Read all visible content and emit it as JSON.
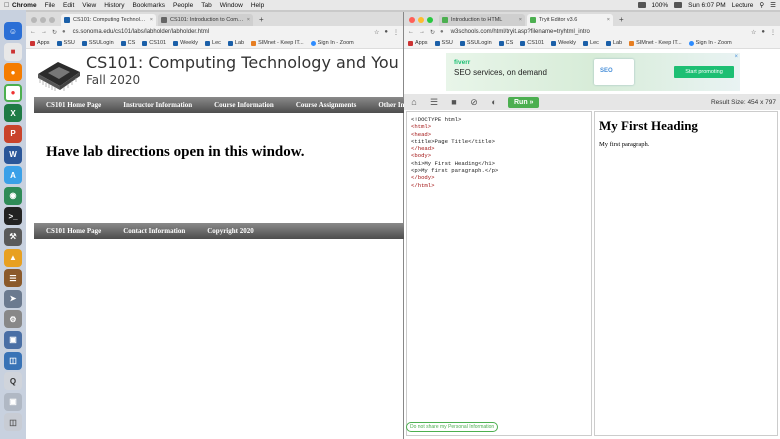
{
  "menubar": {
    "app": "Chrome",
    "items": [
      "File",
      "Edit",
      "View",
      "History",
      "Bookmarks",
      "People",
      "Tab",
      "Window",
      "Help"
    ],
    "battery": "100%",
    "clock": "Sun 6:07 PM",
    "user": "Lecture"
  },
  "left_window": {
    "tabs": [
      {
        "title": "CS101: Computing Technolog...",
        "active": true
      },
      {
        "title": "CS101: Introduction to Compu...",
        "active": false
      }
    ],
    "url": "cs.sonoma.edu/cs101/labs/labholder/labholder.html",
    "bookmarks": [
      "Apps",
      "SSU",
      "SSULogin",
      "CS",
      "CS101",
      "Weekly",
      "Lec",
      "Lab",
      "SIMnet - Keep IT...",
      "Sign In - Zoom"
    ],
    "page": {
      "title": "CS101: Computing Technology and You",
      "subtitle": "Fall 2020",
      "nav": [
        "CS101 Home Page",
        "Instructor Information",
        "Course Information",
        "Course Assignments",
        "Other Information"
      ],
      "heading": "Have lab directions open in this window.",
      "footer": [
        "CS101 Home Page",
        "Contact Information",
        "Copyright 2020"
      ]
    }
  },
  "right_window": {
    "tabs": [
      {
        "title": "Introduction to HTML",
        "active": false
      },
      {
        "title": "Tryit Editor v3.6",
        "active": true
      }
    ],
    "url": "w3schools.com/html/tryit.asp?filename=tryhtml_intro",
    "bookmarks": [
      "Apps",
      "SSU",
      "SSULogin",
      "CS",
      "CS101",
      "Weekly",
      "Lec",
      "Lab",
      "SIMnet - Keep IT...",
      "Sign In - Zoom"
    ],
    "ad": {
      "brand": "fiverr",
      "message": "SEO services, on demand",
      "button": "Start promoting",
      "card_text": "SEO"
    },
    "toolbar": {
      "run_label": "Run »",
      "result_size": "Result Size:  454 x 797"
    },
    "code_lines": [
      "<!DOCTYPE html>",
      "<html>",
      "<head>",
      "<title>Page Title</title>",
      "</head>",
      "<body>",
      "",
      "<h1>My First Heading</h1>",
      "<p>My first paragraph.</p>",
      "",
      "</body>",
      "</html>"
    ],
    "result": {
      "heading": "My First Heading",
      "paragraph": "My first paragraph."
    },
    "privacy_button": "Do not share my Personal Information"
  },
  "colors": {
    "run_green": "#4caf50",
    "fiverr_green": "#1dbf73",
    "nav_gray": "#5e5e5e",
    "code_tag": "#a31515"
  }
}
